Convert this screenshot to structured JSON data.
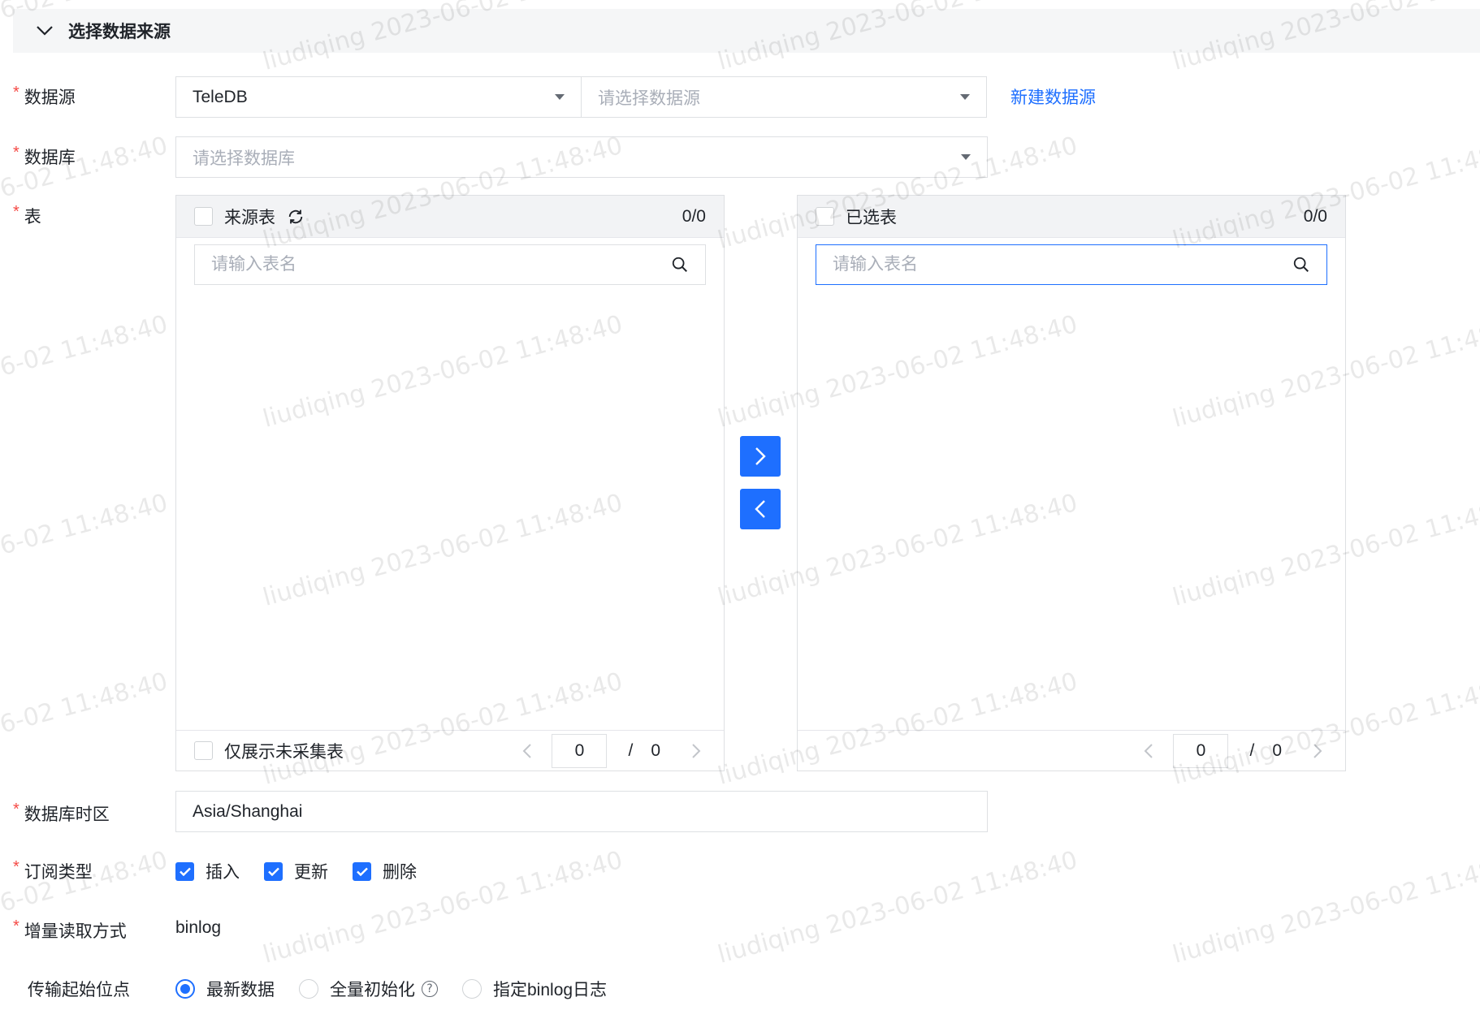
{
  "section": {
    "title": "选择数据来源"
  },
  "form": {
    "datasource": {
      "label": "数据源",
      "type_value": "TeleDB",
      "instance_placeholder": "请选择数据源",
      "new_link": "新建数据源"
    },
    "database": {
      "label": "数据库",
      "placeholder": "请选择数据库"
    },
    "table": {
      "label": "表",
      "source_panel": {
        "title": "来源表",
        "count": "0/0",
        "search_placeholder": "请输入表名",
        "footer_checkbox_label": "仅展示未采集表",
        "page_current": "0",
        "page_sep": "/",
        "page_total": "0"
      },
      "selected_panel": {
        "title": "已选表",
        "count": "0/0",
        "search_placeholder": "请输入表名",
        "page_current": "0",
        "page_sep": "/",
        "page_total": "0"
      }
    },
    "timezone": {
      "label": "数据库时区",
      "value": "Asia/Shanghai"
    },
    "subscribe": {
      "label": "订阅类型",
      "options": [
        {
          "label": "插入",
          "checked": true
        },
        {
          "label": "更新",
          "checked": true
        },
        {
          "label": "删除",
          "checked": true
        }
      ]
    },
    "incremental": {
      "label": "增量读取方式",
      "value": "binlog"
    },
    "start_position": {
      "label": "传输起始位点",
      "options": [
        {
          "label": "最新数据",
          "selected": true
        },
        {
          "label": "全量初始化",
          "selected": false
        },
        {
          "label": "指定binlog日志",
          "selected": false
        }
      ]
    }
  },
  "watermark": {
    "text": "liudiqing 2023-06-02 11:48:40"
  },
  "colors": {
    "primary": "#1e6fff",
    "required": "#f54a45",
    "border": "#dee0e3",
    "header_bg": "#f5f6f7"
  }
}
